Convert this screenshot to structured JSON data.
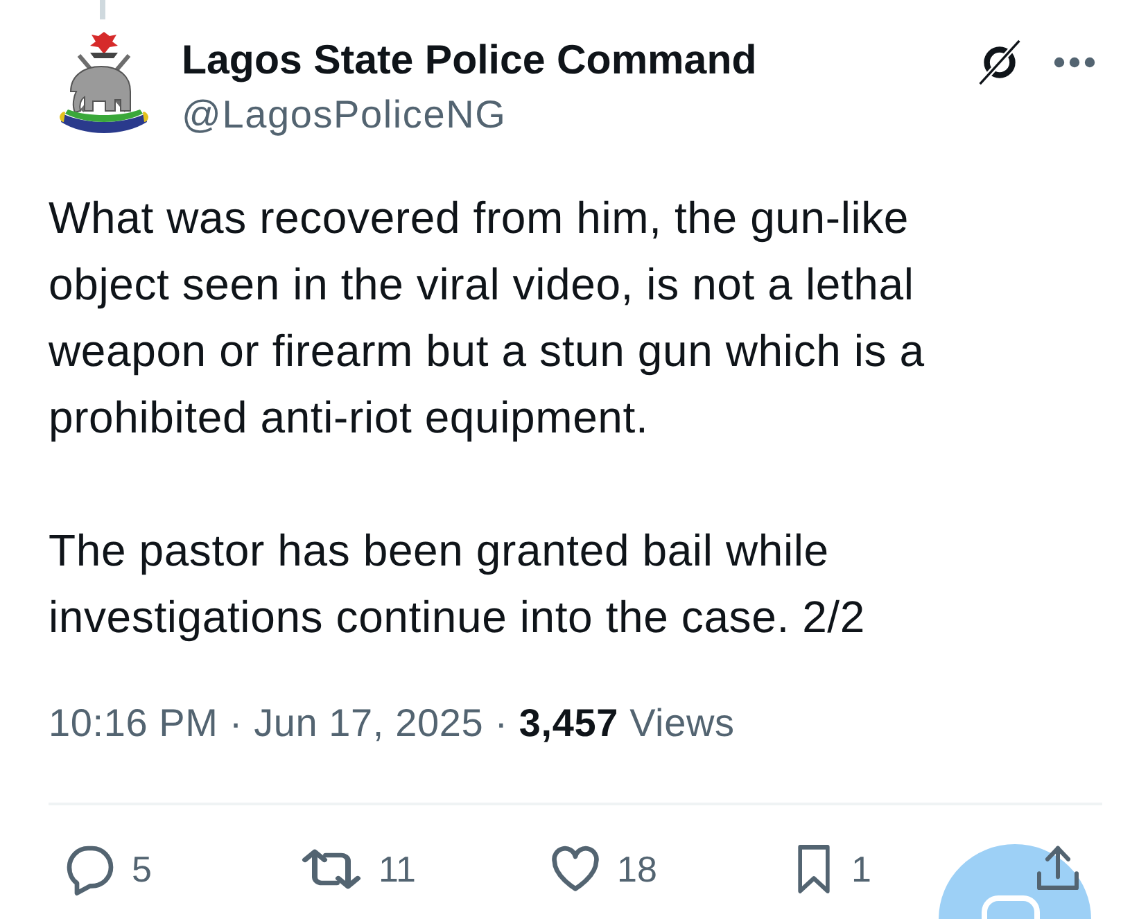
{
  "author": {
    "name": "Lagos State Police Command",
    "handle": "@LagosPoliceNG"
  },
  "post": {
    "paragraphs": [
      "What was recovered from him, the gun-like object seen in the viral video, is not a lethal weapon or firearm but a stun gun which is a prohibited anti-riot equipment.",
      "The pastor has been granted bail while investigations continue into the case. 2/2"
    ],
    "time": "10:16 PM",
    "separator_1": "·",
    "date": "Jun 17, 2025",
    "separator_2": "·",
    "views": {
      "count": "3,457",
      "label": "Views"
    }
  },
  "actions": [
    {
      "kind": "reply",
      "count": "5"
    },
    {
      "kind": "repost",
      "count": "11"
    },
    {
      "kind": "like",
      "count": "18"
    },
    {
      "kind": "bookmark",
      "count": "1"
    },
    {
      "kind": "share"
    }
  ]
}
